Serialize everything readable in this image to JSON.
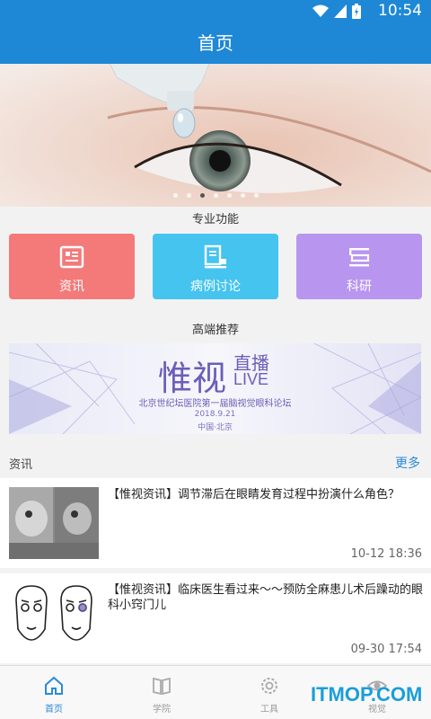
{
  "status_bar": {
    "time": "10:54"
  },
  "app_bar": {
    "title": "首页"
  },
  "hero": {
    "dot_count": 7,
    "active_dot": 2
  },
  "features": {
    "section_title": "专业功能",
    "items": [
      {
        "label": "资讯",
        "color": "#f47a7a",
        "icon": "news-icon"
      },
      {
        "label": "病例讨论",
        "color": "#44c4ef",
        "icon": "case-icon"
      },
      {
        "label": "科研",
        "color": "#b896f0",
        "icon": "research-icon"
      }
    ]
  },
  "recommend": {
    "section_title": "高端推荐",
    "banner": {
      "title_main": "惟视",
      "title_live_cn": "直播",
      "title_live_en": "LIVE",
      "subtitle": "北京世纪坛医院第一届脑视觉眼科论坛",
      "date": "2018.9.21",
      "place": "中国·北京"
    }
  },
  "news": {
    "header": "资讯",
    "more": "更多",
    "items": [
      {
        "title": "【惟视资讯】调节滞后在眼睛发育过程中扮演什么角色？",
        "time": "10-12 18:36"
      },
      {
        "title": "【惟视资讯】临床医生看过来～～预防全麻患儿术后躁动的眼科小窍门儿",
        "time": "09-30 17:54"
      }
    ]
  },
  "tabs": [
    {
      "label": "首页",
      "icon": "home-icon",
      "active": true
    },
    {
      "label": "学院",
      "icon": "book-icon",
      "active": false
    },
    {
      "label": "工具",
      "icon": "gear-icon",
      "active": false
    },
    {
      "label": "视觉",
      "icon": "eye-icon",
      "active": false
    }
  ],
  "watermark": "ITMOP.COM",
  "colors": {
    "primary": "#1e88d6",
    "link": "#2b8ad8"
  }
}
